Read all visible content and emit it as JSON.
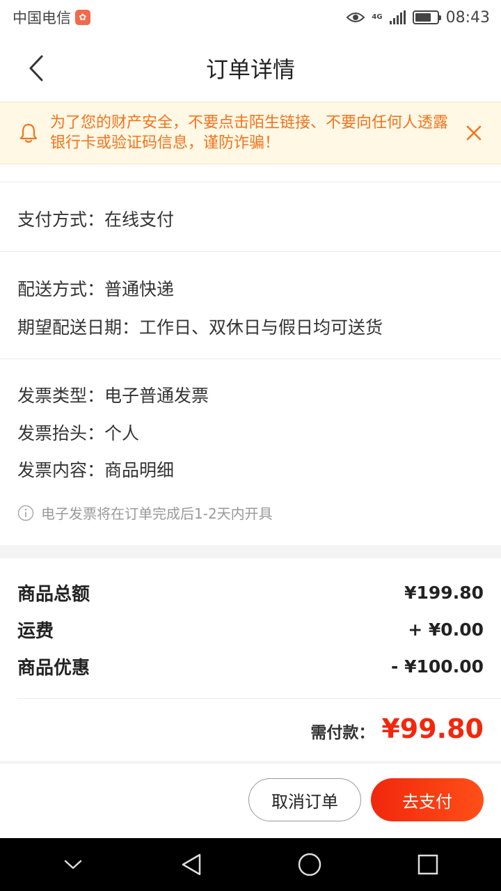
{
  "status_bar": {
    "carrier": "中国电信",
    "network": "4G",
    "time": "08:43",
    "battery_level": 0.75
  },
  "nav": {
    "title": "订单详情",
    "back_icon": "chevron-left-icon"
  },
  "notice": {
    "icon": "bell-icon",
    "text": "为了您的财产安全，不要点击陌生链接、不要向任何人透露银行卡或验证码信息，谨防诈骗！",
    "close_icon": "close-icon"
  },
  "payment": {
    "method": "支付方式：在线支付"
  },
  "delivery": {
    "method": "配送方式：普通快递",
    "date": "期望配送日期：工作日、双休日与假日均可送货"
  },
  "invoice": {
    "type": "发票类型：电子普通发票",
    "title": "发票抬头：个人",
    "content": "发票内容：商品明细",
    "note": "电子发票将在订单完成后1-2天内开具"
  },
  "fees": [
    {
      "label": "商品总额",
      "value": "¥199.80"
    },
    {
      "label": "运费",
      "value": "+ ¥0.00"
    },
    {
      "label": "商品优惠",
      "value": "- ¥100.00"
    }
  ],
  "total": {
    "label": "需付款：",
    "amount": "¥99.80"
  },
  "actions": {
    "cancel_label": "取消订单",
    "pay_label": "去支付"
  },
  "colors": {
    "accent": "#f2270c",
    "notice_text": "#f2731d",
    "notice_bg": "#fff8e5"
  }
}
